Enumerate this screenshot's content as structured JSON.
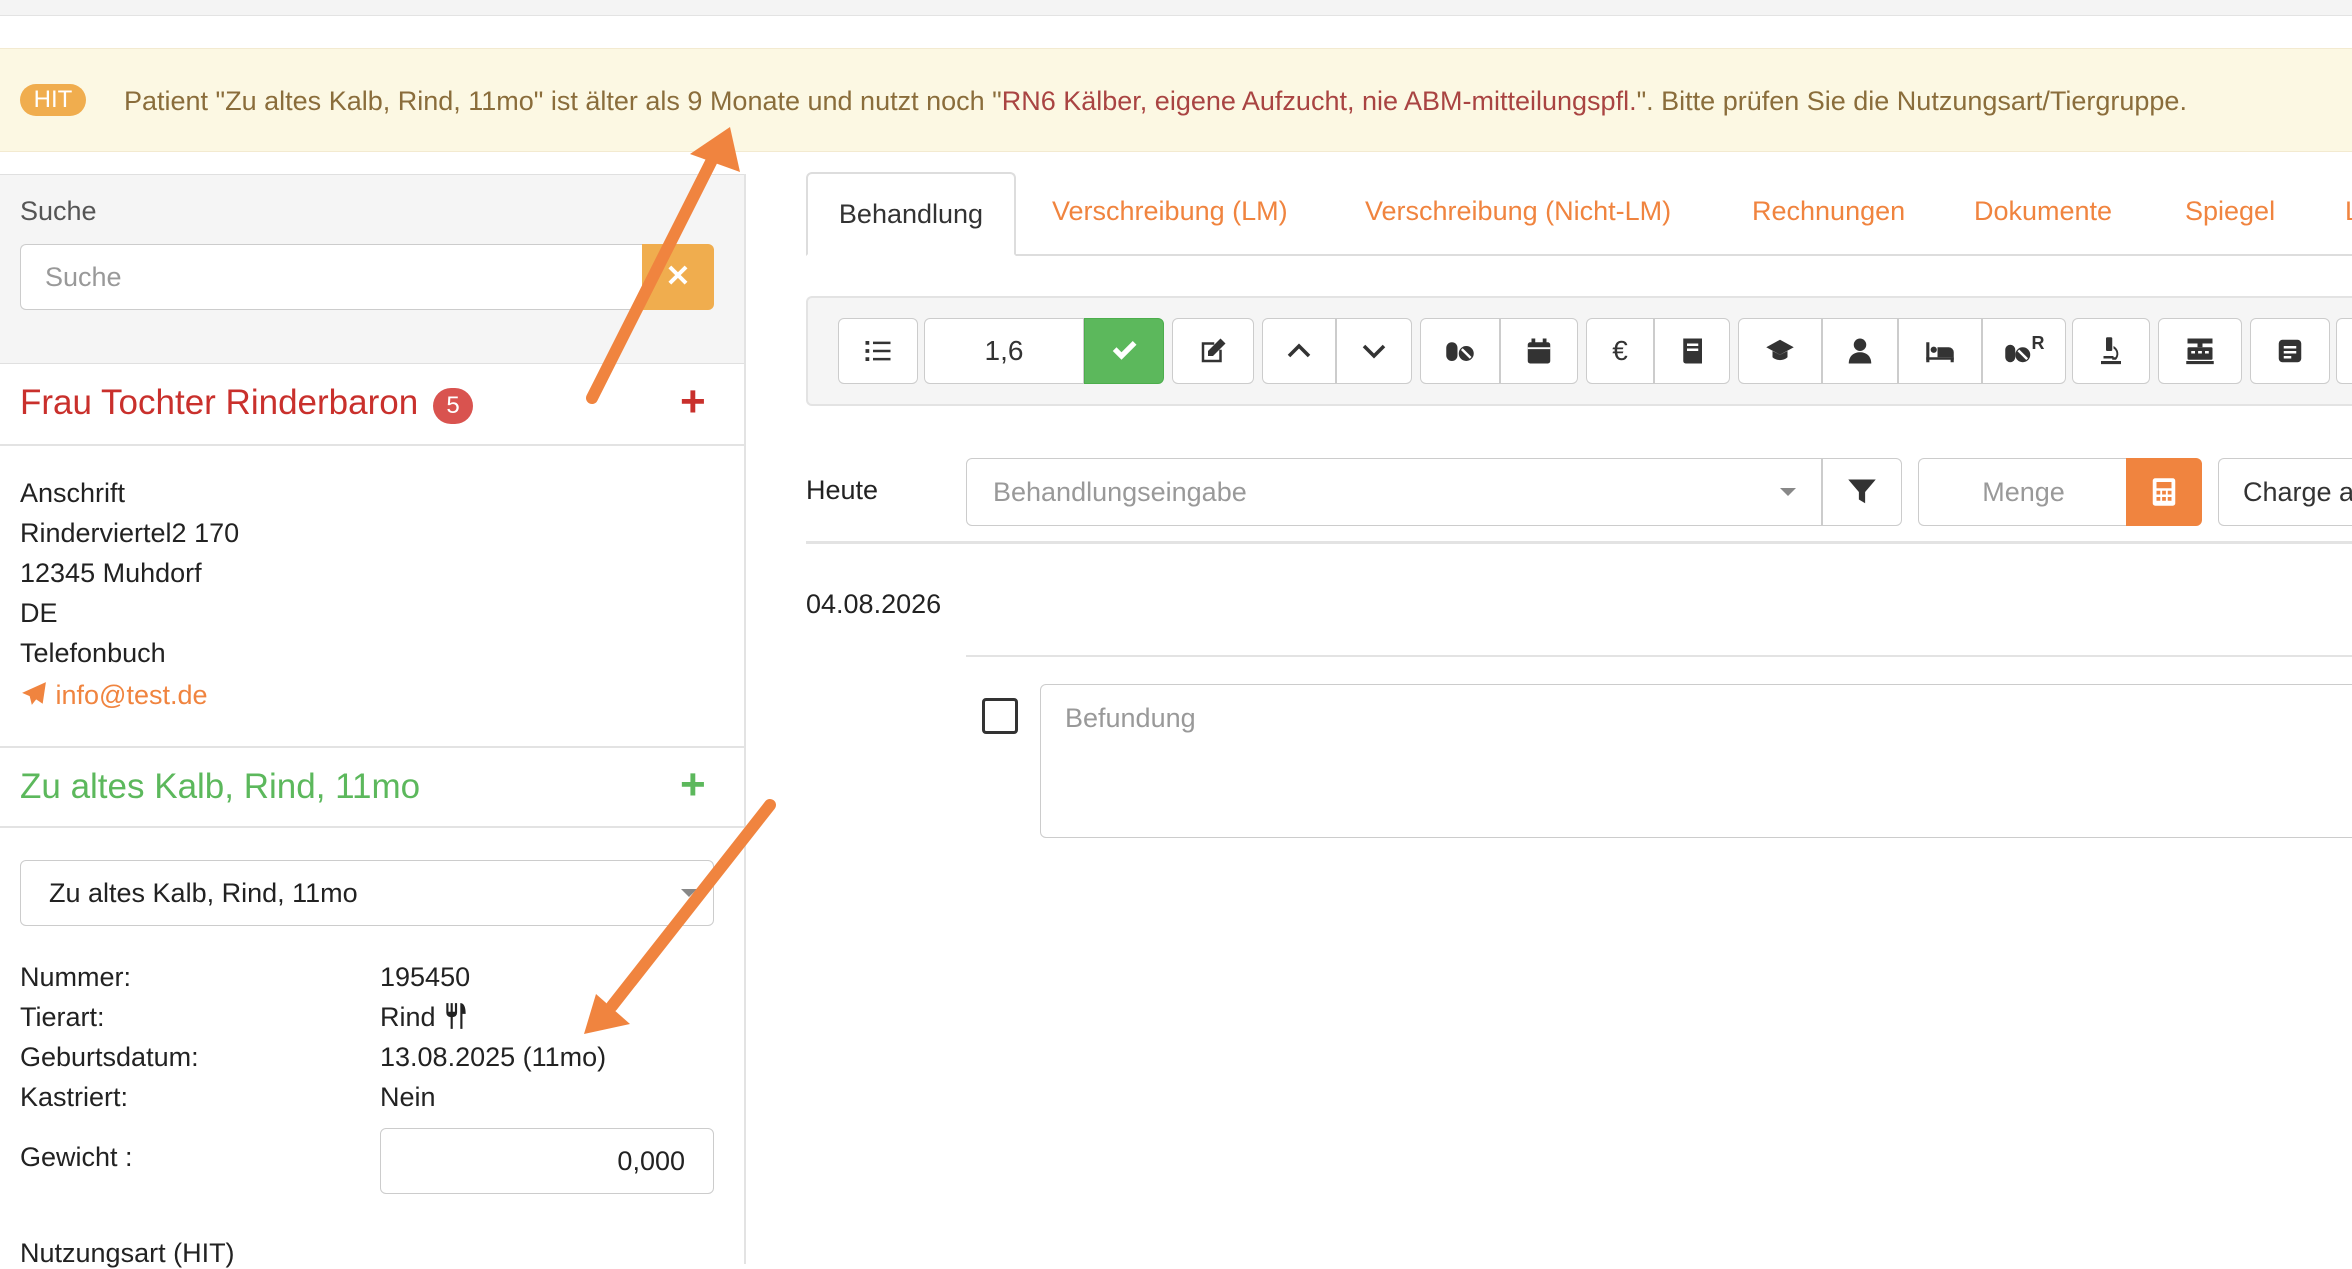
{
  "alert": {
    "badge": "HIT",
    "text_prefix": "Patient \"Zu altes Kalb, Rind, 11mo\" ist älter als 9 Monate und nutzt noch \"",
    "text_highlight": "RN6 Kälber, eigene Aufzucht, nie ABM-mitteilungspfl.",
    "text_suffix": "\". Bitte prüfen Sie die Nutzungsart/Tiergruppe."
  },
  "search": {
    "label": "Suche",
    "placeholder": "Suche",
    "clear_icon": "times-icon"
  },
  "owner": {
    "name": "Frau Tochter Rinderbaron",
    "badge": "5",
    "add_icon": "plus-icon",
    "address_label": "Anschrift",
    "street": "Rinderviertel2 170",
    "city": "12345  Muhdorf",
    "country": "DE",
    "phonebook": "Telefonbuch",
    "email": "info@test.de"
  },
  "animal": {
    "name": "Zu altes Kalb, Rind, 11mo",
    "add_icon": "plus-icon",
    "select_value": "Zu altes Kalb, Rind, 11mo",
    "fields": {
      "nummer_label": "Nummer:",
      "nummer_value": "195450",
      "tierart_label": "Tierart:",
      "tierart_value": "Rind",
      "geburtsdatum_label": "Geburtsdatum:",
      "geburtsdatum_value": "13.08.2025  (11mo)",
      "kastriert_label": "Kastriert:",
      "kastriert_value": "Nein",
      "gewicht_label": "Gewicht :",
      "gewicht_value": "0,000",
      "nutzungsart_label": "Nutzungsart (HIT)"
    }
  },
  "tabs": [
    {
      "label": "Behandlung",
      "active": true
    },
    {
      "label": "Verschreibung (LM)"
    },
    {
      "label": "Verschreibung (Nicht-LM)"
    },
    {
      "label": "Rechnungen"
    },
    {
      "label": "Dokumente"
    },
    {
      "label": "Spiegel"
    },
    {
      "label": "L"
    }
  ],
  "toolbar": {
    "zoom_value": "1,6",
    "icons": [
      "list-icon",
      "check-icon",
      "edit-icon",
      "chevron-up-icon",
      "chevron-down-icon",
      "pills-icon",
      "calendar-icon",
      "euro-icon",
      "book-icon",
      "graduation-cap-icon",
      "user-icon",
      "bed-icon",
      "pills-r-icon",
      "microscope-icon",
      "cash-register-icon",
      "notes-icon"
    ],
    "euro_symbol": "€",
    "pills_r_sup": "R"
  },
  "entry": {
    "date_label": "Heute",
    "treatment_placeholder": "Behandlungseingabe",
    "amount_placeholder": "Menge",
    "charge_text": "Charge a"
  },
  "record": {
    "date": "04.08.2026",
    "findings_placeholder": "Befundung"
  },
  "colors": {
    "accent": "#f0843f",
    "danger": "#c9302c",
    "success": "#5cb85c",
    "warning_bg": "#fcf8e3",
    "warning_text": "#8a6d3b"
  }
}
